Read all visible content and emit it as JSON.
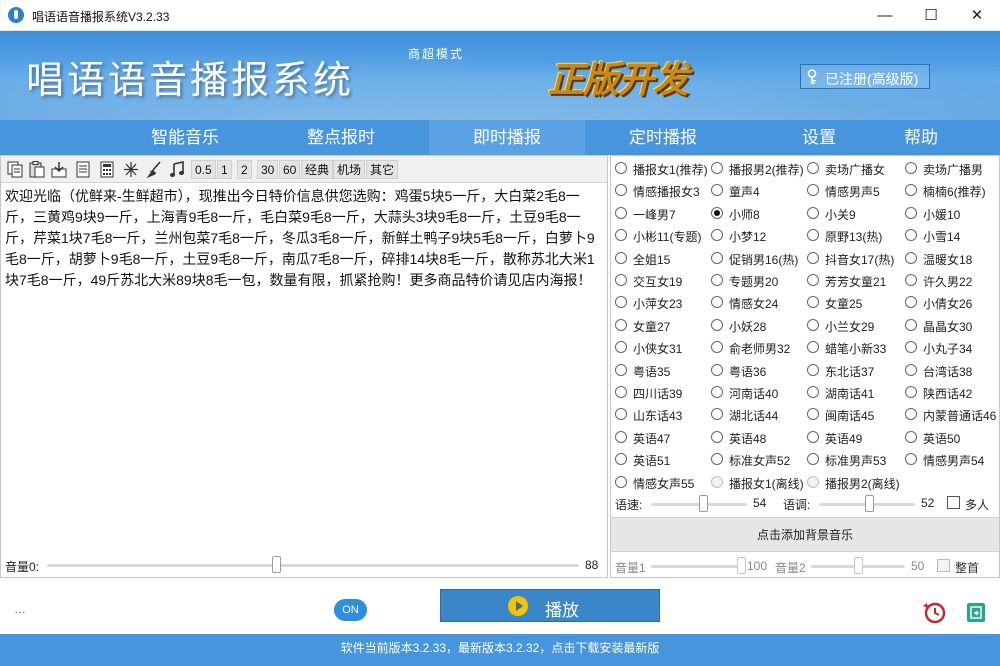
{
  "window": {
    "title": "唱语语音播报系统V3.2.33",
    "minimize": "—",
    "maximize": "☐",
    "close": "✕"
  },
  "banner": {
    "title": "唱语语音播报系统",
    "subtitle": "商超模式",
    "stamp": "正版开发",
    "registered": "已注册(高级版)"
  },
  "nav": {
    "tabs": [
      {
        "label": "智能音乐"
      },
      {
        "label": "整点报时"
      },
      {
        "label": "即时播报"
      },
      {
        "label": "定时播报"
      },
      {
        "label": "设置"
      },
      {
        "label": "帮助"
      }
    ],
    "active": "即时播报"
  },
  "toolbar": {
    "icons": [
      "copy-icon",
      "paste-icon",
      "import-icon",
      "document-icon",
      "calculator-icon",
      "sparkle-icon",
      "broom-icon",
      "music-note-icon"
    ],
    "buttons": [
      "0.5",
      "1",
      "2",
      "30",
      "60",
      "经典",
      "机场",
      "其它"
    ]
  },
  "editor": {
    "text": "欢迎光临（优鲜来-生鲜超市），现推出今日特价信息供您选购：鸡蛋5块5一斤，大白菜2毛8一斤，三黄鸡9块9一斤，上海青9毛8一斤，毛白菜9毛8一斤，大蒜头3块9毛8一斤，土豆9毛8一斤，芹菜1块7毛8一斤，兰州包菜7毛8一斤，冬瓜3毛8一斤，新鲜土鸭子9块5毛8一斤，白萝卜9毛8一斤，胡萝卜9毛8一斤，土豆9毛8一斤，南瓜7毛8一斤，碎排14块8毛一斤，散称苏北大米1块7毛8一斤，49斤苏北大米89块8毛一包，数量有限，抓紧抢购！更多商品特价请见店内海报！"
  },
  "volume": {
    "label": "音量0:",
    "value": "88",
    "level": 0.88
  },
  "voices": [
    [
      "播报女1(推荐)",
      "播报男2(推荐)",
      "卖场广播女",
      "卖场广播男"
    ],
    [
      "情感播报女3",
      "童声4",
      "情感男声5",
      "楠楠6(推荐)"
    ],
    [
      "一峰男7",
      "小师8",
      "小关9",
      "小媛10"
    ],
    [
      "小彬11(专题)",
      "小梦12",
      "原野13(热)",
      "小雪14"
    ],
    [
      "全姐15",
      "促销男16(热)",
      "抖音女17(热)",
      "温暖女18"
    ],
    [
      "交互女19",
      "专题男20",
      "芳芳女童21",
      "许久男22"
    ],
    [
      "小萍女23",
      "情感女24",
      "女童25",
      "小倩女26"
    ],
    [
      "女童27",
      "小妖28",
      "小兰女29",
      "晶晶女30"
    ],
    [
      "小侠女31",
      "俞老师男32",
      "蜡笔小新33",
      "小丸子34"
    ],
    [
      "粤语35",
      "粤语36",
      "东北话37",
      "台湾话38"
    ],
    [
      "四川话39",
      "河南话40",
      "湖南话41",
      "陕西话42"
    ],
    [
      "山东话43",
      "湖北话44",
      "闽南话45",
      "内蒙普通话46"
    ],
    [
      "英语47",
      "英语48",
      "英语49",
      "英语50"
    ],
    [
      "英语51",
      "标准女声52",
      "标准男声53",
      "情感男声54"
    ],
    [
      "情感女声55",
      "播报女1(离线)",
      "播报男2(离线)"
    ]
  ],
  "selected_voice": "小师8",
  "speed": {
    "label": "语速:",
    "value": "54",
    "level": 0.54
  },
  "pitch": {
    "label": "语调:",
    "value": "52",
    "level": 0.52
  },
  "multi_person": {
    "label": "多人",
    "checked": false
  },
  "bgm": {
    "add_label": "点击添加背景音乐",
    "vol1_label": "音量1",
    "vol1_value": "100",
    "vol1_level": 1.0,
    "vol2_label": "音量2",
    "vol2_value": "50",
    "vol2_level": 0.5,
    "whole_point_label": "整首"
  },
  "bottom": {
    "dots": "…",
    "on_badge": "ON",
    "play_label": "播放"
  },
  "status": {
    "text": "软件当前版本3.2.33，最新版本3.2.32，点击下载安装最新版"
  },
  "colors": {
    "nav_bg": "#4795dd",
    "nav_active": "#5aa2e3",
    "play_button": "#3a86c8",
    "status_bar": "#4795dd",
    "on_badge": "#2d8fe0"
  }
}
